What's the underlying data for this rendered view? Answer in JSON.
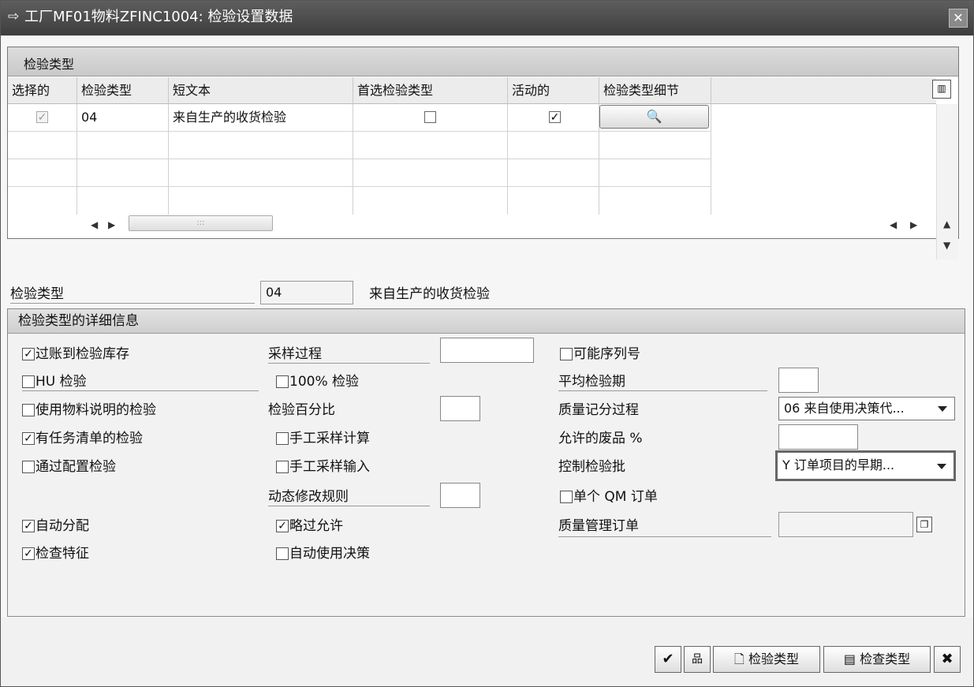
{
  "window": {
    "title": "工厂MF01物料ZFINC1004: 检验设置数据",
    "close_label": "✕"
  },
  "grid": {
    "title": "检验类型",
    "columns": [
      "选择的",
      "检验类型",
      "短文本",
      "首选检验类型",
      "活动的",
      "检验类型细节"
    ],
    "rows": [
      {
        "selected": true,
        "type": "04",
        "short_text": "来自生产的收货检验",
        "preferred": false,
        "active": true
      }
    ]
  },
  "header_field": {
    "label": "检验类型",
    "value": "04",
    "description": "来自生产的收货检验"
  },
  "details": {
    "title": "检验类型的详细信息",
    "col1": [
      {
        "label": "过账到检验库存",
        "checked": true
      },
      {
        "label": "HU 检验",
        "checked": false
      },
      {
        "label": "使用物料说明的检验",
        "checked": false
      },
      {
        "label": "有任务清单的检验",
        "checked": true
      },
      {
        "label": "通过配置检验",
        "checked": false
      },
      {
        "label": "自动分配",
        "checked": true
      },
      {
        "label": "检查特征",
        "checked": true
      }
    ],
    "col2": {
      "sampling_procedure_label": "采样过程",
      "sampling_procedure_value": "",
      "check100_label": "100% 检验",
      "check100_checked": false,
      "inspection_percent_label": "检验百分比",
      "inspection_percent_value": "",
      "manual_sample_calc_label": "手工采样计算",
      "manual_sample_calc_checked": false,
      "manual_sample_input_label": "手工采样输入",
      "manual_sample_input_checked": false,
      "dynamic_rule_label": "动态修改规则",
      "dynamic_rule_value": "",
      "skip_allowed_label": "略过允许",
      "skip_allowed_checked": true,
      "auto_ud_label": "自动使用决策",
      "auto_ud_checked": false
    },
    "col3": {
      "serial_label": "可能序列号",
      "serial_checked": false,
      "avg_duration_label": "平均检验期",
      "avg_duration_value": "",
      "qscore_label": "质量记分过程",
      "qscore_value": "06 来自使用决策代...",
      "allowed_scrap_label": "允许的废品 %",
      "allowed_scrap_value": "",
      "control_lot_label": "控制检验批",
      "control_lot_value": "Y 订单项目的早期...",
      "single_qm_label": "单个 QM 订单",
      "single_qm_checked": false,
      "qm_order_label": "质量管理订单",
      "qm_order_value": ""
    }
  },
  "toolbar": {
    "inspection_type_label": "检验类型",
    "check_type_label": "检查类型"
  },
  "icons": {
    "checkmark": "✓",
    "confirm": "✔",
    "cancel": "✖"
  }
}
